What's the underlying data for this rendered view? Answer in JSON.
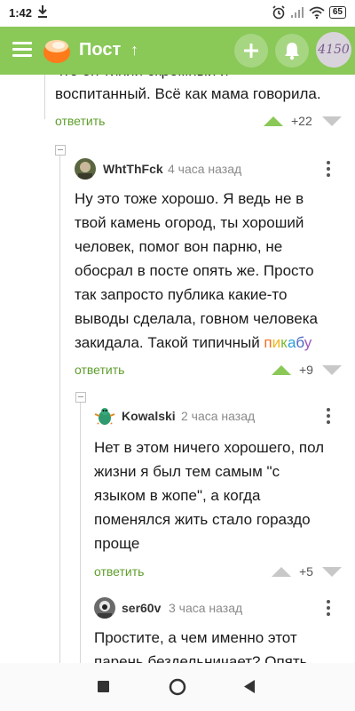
{
  "status": {
    "time": "1:42",
    "battery": "65"
  },
  "app": {
    "title": "Пост"
  },
  "prev_comment": {
    "line1": "что он тихий скромный и",
    "line2": "воспитанный. Всё как мама говорила.",
    "reply": "ответить",
    "rating": "+22"
  },
  "comments": [
    {
      "author": "WhtThFck",
      "time": "4 часа назад",
      "lines": [
        "Ну это тоже хорошо. Я ведь не в",
        "твой камень огород, ты хороший",
        "человек, помог вон парню, не",
        "обосрал в посте опять же. Просто",
        "так запросто публика какие-то",
        "выводы сделала, говном человека",
        "закидала. Такой типичный "
      ],
      "brand": [
        "п",
        "и",
        "к",
        "а",
        "б",
        "у"
      ],
      "reply": "ответить",
      "rating": "+9"
    },
    {
      "author": "Kowalski",
      "time": "2 часа назад",
      "lines": [
        "Нет в этом ничего хорошего, пол",
        "жизни я был тем самым \"с",
        "языком в жопе\", а когда",
        "поменялся жить стало гораздо",
        "проще"
      ],
      "reply": "ответить",
      "rating": "+5"
    },
    {
      "author": "ser60v",
      "time": "3 часа назад",
      "lines": [
        "Простите, а чем именно этот",
        "парень бездельничает? Опять"
      ]
    }
  ],
  "colors": {
    "accent": "#8ac858",
    "link": "#5e9e2c"
  }
}
